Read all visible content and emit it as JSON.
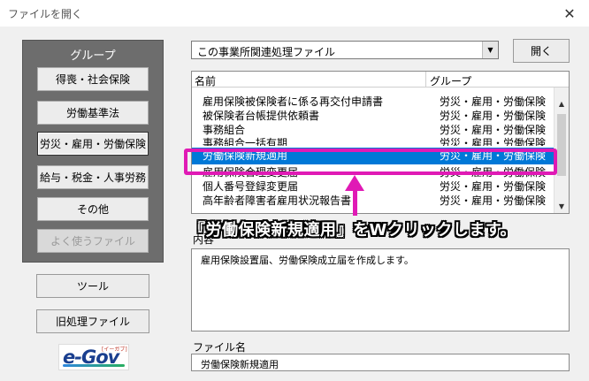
{
  "window": {
    "title": "ファイルを開く",
    "close_glyph": "✕"
  },
  "group_panel": {
    "header": "グループ",
    "buttons": [
      {
        "label": "得喪・社会保険"
      },
      {
        "label": "労働基準法"
      },
      {
        "label": "労災・雇用・労働保険"
      },
      {
        "label": "給与・税金・人事労務"
      },
      {
        "label": "その他"
      },
      {
        "label": "よく使うファイル"
      }
    ]
  },
  "side_buttons": {
    "tools": "ツール",
    "old_files": "旧処理ファイル"
  },
  "egov_logo": {
    "text": "e-Gov",
    "ruby": "[イーガブ]"
  },
  "combo": {
    "value": "この事業所関連処理ファイル",
    "arrow": "▼"
  },
  "open_button": "開く",
  "list": {
    "headers": {
      "name": "名前",
      "group": "グループ"
    },
    "rows": [
      {
        "name": "雇用保険被保険者に係る再交付申請書",
        "group": "労災・雇用・労働保険"
      },
      {
        "name": "被保険者台帳提供依頼書",
        "group": "労災・雇用・労働保険"
      },
      {
        "name": "事務組合",
        "group": "労災・雇用・労働保険"
      },
      {
        "name": "事務組合一括有期",
        "group": "労災・雇用・労働保険"
      },
      {
        "name": "労働保険新規適用",
        "group": "労災・雇用・労働保険",
        "selected": true
      },
      {
        "name": "雇用保険合理変更届",
        "group": "労災・雇用・労働保険"
      },
      {
        "name": "個人番号登録変更届",
        "group": "労災・雇用・労働保険"
      },
      {
        "name": "高年齢者障害者雇用状況報告書",
        "group": "労災・雇用・労働保険"
      }
    ],
    "scroll_up": "▲",
    "scroll_down": "▼"
  },
  "callout": "『労働保険新規適用』をWクリックします。",
  "contents": {
    "label": "内容",
    "text": "雇用保険設置届、労働保険成立届を作成します。"
  },
  "filename": {
    "label": "ファイル名",
    "value": "労働保険新規適用"
  },
  "colors": {
    "highlight": "#e01ab5",
    "selection": "#0078d7",
    "panel": "#6d6d6d"
  }
}
